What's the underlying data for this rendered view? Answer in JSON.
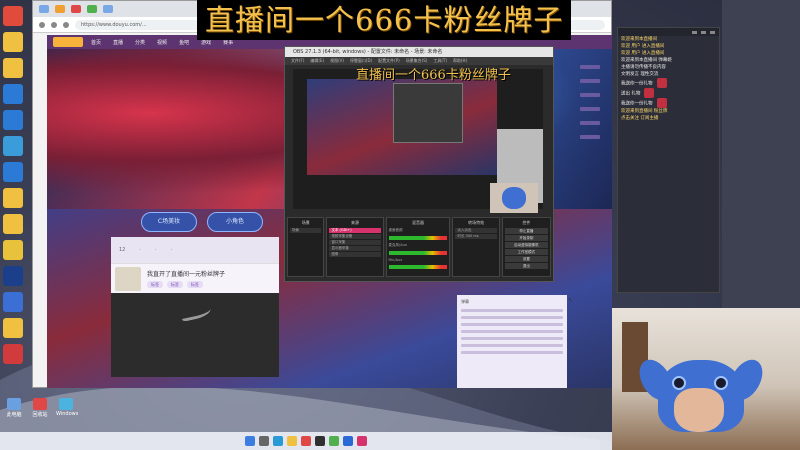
{
  "overlay_title": "直播间一个666卡粉丝牌子",
  "obs_overlay_title": "直播间一个666卡粉丝牌子",
  "browser": {
    "url": "https://www.douyu.com/..."
  },
  "site": {
    "nav_items": [
      "首页",
      "直播",
      "分类",
      "视频",
      "鱼吧",
      "游戏",
      "赛事"
    ],
    "pill_left": "C场美妆",
    "pill_right": "小角色",
    "stream_title": "我直开了直播间一元粉丝牌子",
    "stream_tags": [
      "标签",
      "标签",
      "标签"
    ],
    "panel_counts": [
      "12",
      "·",
      "·",
      "·"
    ],
    "chat_header": "弹幕"
  },
  "obs": {
    "title": "OBS 27.1.3 (64-bit, windows) - 配置文件: 未命名 - 场景: 未命名",
    "menu": [
      "文件(F)",
      "编辑(E)",
      "视图(V)",
      "停靠窗口(D)",
      "配置文件(P)",
      "场景集合(S)",
      "工具(T)",
      "帮助(H)"
    ],
    "docks": {
      "scenes_header": "场景",
      "sources_header": "来源",
      "mixer_header": "混音器",
      "transitions_header": "转场特效",
      "controls_header": "控件"
    },
    "scene_items": [
      "场景"
    ],
    "source_items": [
      "文本 (GDI+)",
      "视频采集设备",
      "窗口采集",
      "显示器采集",
      "图像"
    ],
    "mixer_items": [
      "桌面音频",
      "麦克风/Aux",
      "Mic/Aux"
    ],
    "transition_items": [
      "淡入淡出",
      "时长 300 ms"
    ],
    "control_buttons": [
      "停止直播",
      "开始录制",
      "启动虚拟摄像机",
      "工作室模式",
      "设置",
      "退出"
    ]
  },
  "danmaku": {
    "lines": [
      {
        "text": "欢迎来到本直播间",
        "color": "#ffd86a"
      },
      {
        "text": "欢迎 用户 进入直播间",
        "color": "#ffd86a"
      },
      {
        "text": "欢迎 用户 进入直播间",
        "color": "#ffd86a"
      },
      {
        "text": "欢迎来到本直播间 弹幕姬",
        "color": "#e8e8e8"
      },
      {
        "text": "主播请勿传播不良内容",
        "color": "#e8e8e8"
      },
      {
        "text": "文明发言 理性交流",
        "color": "#e8e8e8"
      },
      {
        "text": "我送你一份礼物",
        "color": "#e8e8e8"
      },
      {
        "text": "送出 礼物",
        "color": "#e8e8e8"
      },
      {
        "text": "我送你一份礼物",
        "color": "#e8e8e8"
      },
      {
        "text": "欢迎来到直播间 粉丝牌",
        "color": "#ffd86a"
      },
      {
        "text": "点击关注 订阅主播",
        "color": "#ffd86a"
      }
    ]
  },
  "desktop": {
    "bottom_icons": [
      "此电脑",
      "回收站",
      "Windows"
    ]
  },
  "colors": {
    "title_gold": "#f2c14e",
    "obs_bg": "#2b2b2b",
    "source_selected": "#d6336c",
    "stitch_blue": "#3f6fd1"
  }
}
